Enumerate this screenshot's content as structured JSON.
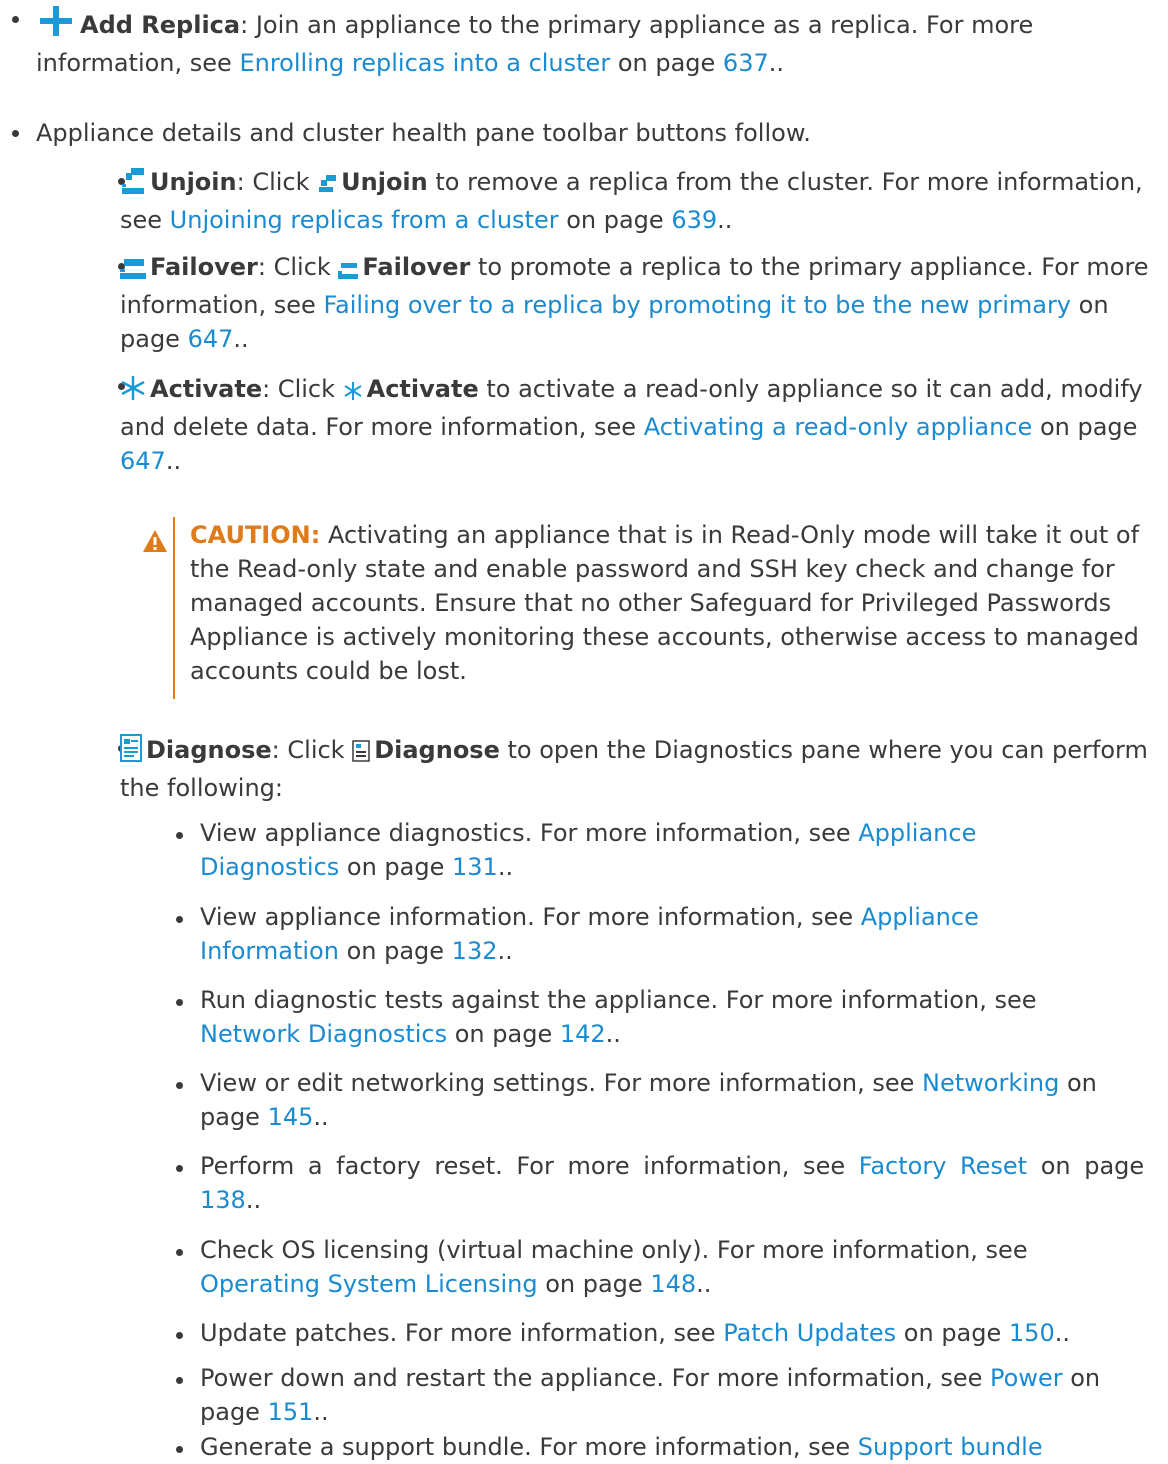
{
  "add_replica": {
    "title": "Add Replica",
    "text": ": Join an appliance to the primary appliance as a replica. For more information, see ",
    "link": "Enrolling replicas into a cluster",
    "on_page": " on page ",
    "page": "637",
    "end": ".."
  },
  "toolbar_intro": "Appliance details and cluster health pane toolbar buttons follow.",
  "unjoin": {
    "title": "Unjoin",
    "click": ": Click ",
    "title2": "Unjoin",
    "text": " to remove a replica from the cluster. For more information, see ",
    "link": "Unjoining replicas from a cluster",
    "on_page": " on page ",
    "page": "639",
    "end": ".."
  },
  "failover": {
    "title": "Failover",
    "click": ": Click ",
    "title2": "Failover",
    "text": " to promote a replica to the primary appliance. For more information, see ",
    "link": "Failing over to a replica by promoting it to be the new primary",
    "on_page": " on page ",
    "page": "647",
    "end": ".."
  },
  "activate": {
    "title": "Activate",
    "click": ": Click ",
    "title2": "Activate",
    "text": " to activate a read-only appliance so it can add, modify and delete data. For more information, see ",
    "link": "Activating a read-only appliance",
    "on_page": " on page ",
    "page": "647",
    "end": ".."
  },
  "caution": {
    "label": "CAUTION:",
    "text": " Activating an appliance that is in Read-Only mode will take it out of the Read-only state and enable password and SSH key check and change for managed accounts. Ensure that no other Safeguard for Privileged Passwords Appliance is actively monitoring these accounts, otherwise access to managed accounts could be lost."
  },
  "diagnose": {
    "title": "Diagnose",
    "click": ": Click ",
    "title2": "Diagnose",
    "text": " to open the Diagnostics pane where you can perform the following:"
  },
  "diag_items": [
    {
      "text": "View appliance diagnostics. For more information, see ",
      "link": "Appliance Diagnostics",
      "page": "131"
    },
    {
      "text": "View appliance information. For more information, see ",
      "link": "Appliance Information",
      "page": "132"
    },
    {
      "text": "Run diagnostic tests against the appliance. For more information, see ",
      "link": "Network Diagnostics",
      "page": "142"
    },
    {
      "text": "View or edit networking settings. For more information, see ",
      "link": "Networking",
      "page": "145"
    },
    {
      "text": "Perform a factory reset. For more information, see ",
      "link": "Factory Reset",
      "page": "138"
    },
    {
      "text": "Check OS licensing (virtual machine only). For more information, see ",
      "link": "Operating System Licensing",
      "page": "148"
    },
    {
      "text": "Update patches. For more information, see ",
      "link": "Patch Updates",
      "page": "150"
    },
    {
      "text": "Power down and restart the appliance. For more information, see ",
      "link": "Power",
      "page": "151"
    },
    {
      "text": "Generate a support bundle. For more information, see ",
      "link": "Support bundle",
      "page": ""
    }
  ],
  "common": {
    "on_page": " on page ",
    "end": ".."
  },
  "colors": {
    "link": "#1a8bd1",
    "caution": "#e07b1a",
    "icon_blue": "#1b9ad8",
    "text": "#3a3a3a"
  },
  "icons": [
    "plus-icon",
    "unjoin-icon",
    "failover-icon",
    "activate-icon",
    "warning-icon",
    "diagnose-icon"
  ]
}
